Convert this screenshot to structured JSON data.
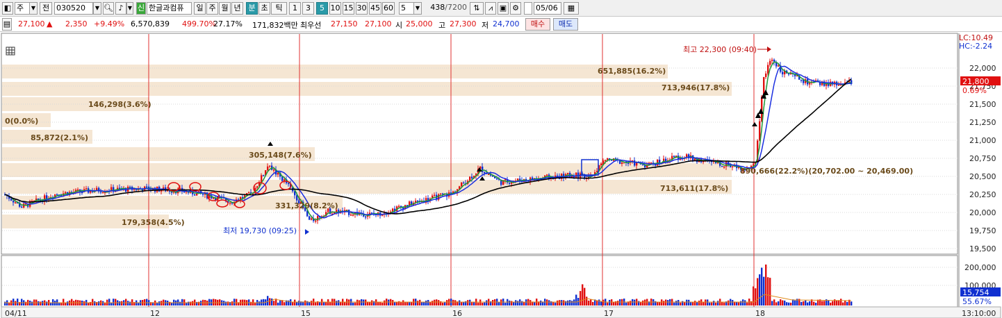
{
  "toolbar": {
    "mode_label": "주",
    "prev_label": "전",
    "code_value": "030520",
    "name_badge": "신",
    "stock_name": "한글과컴퓨",
    "periods": [
      "일",
      "주",
      "월",
      "년",
      "분",
      "초",
      "틱"
    ],
    "active_period": "분",
    "intervals": [
      "1",
      "3",
      "5",
      "10",
      "15",
      "30",
      "45",
      "60"
    ],
    "active_interval": "5",
    "interval_select": "5",
    "count_current": "438",
    "count_max": "/7200",
    "date_value": "05/06"
  },
  "quote": {
    "price": "27,100",
    "change_symbol": "▲",
    "change": "2,350",
    "change_pct": "+9.49%",
    "volume": "6,570,839",
    "volume_ratio": "499.70%",
    "turnover": "27.17%",
    "amount": "171,832백만",
    "best_label": "최우선",
    "best_ask": "27,150",
    "best_bid": "27,100",
    "open_label": "시",
    "open": "25,000",
    "high_label": "고",
    "high": "27,300",
    "low_label": "저",
    "low": "24,700",
    "buy_label": "매수",
    "sell_label": "매도"
  },
  "chart": {
    "lc_label": "LC:10.49",
    "hc_label": "HC:-2.24",
    "price_ticks": [
      "22,000",
      "21,750",
      "21,500",
      "21,250",
      "21,000",
      "20,750",
      "20,500",
      "20,250",
      "20,000",
      "19,750",
      "19,500"
    ],
    "current_price": "21,800",
    "current_pct": "0.69%",
    "volume_ticks": [
      "200,000",
      "100,000"
    ],
    "current_volume": "15,754",
    "current_volume_pct": "55.67%",
    "date_labels": [
      "04/11",
      "12",
      "15",
      "16",
      "17",
      "18"
    ],
    "time_label": "13:10:00",
    "high_annotation": "최고 22,300 (09:40)",
    "low_annotation": "최저 19,730 (09:25)",
    "volume_profile_labels": [
      "651,885(16.2%)",
      "713,946(17.8%)",
      "146,298(3.6%)",
      "0(0.0%)",
      "85,872(2.1%)",
      "305,148(7.6%)",
      "331,329(8.2%)",
      "179,358(4.5%)",
      "713,611(17.8%)",
      "890,666(22.2%)(20,702.00 ~ 20,469.00)"
    ]
  },
  "colors": {
    "up": "#e01010",
    "down": "#1030d0",
    "ma_short": "#1d9a3a",
    "ma_mid": "#1a2ee0",
    "ma_long": "#000000",
    "profile": "#f5e6d3",
    "active_button": "#2a9aa8"
  },
  "icons": [
    "grid-icon",
    "search-icon",
    "speaker-icon",
    "settings-icon",
    "save-icon",
    "dual-chart-icon",
    "indicator-icon",
    "calculator-icon"
  ]
}
